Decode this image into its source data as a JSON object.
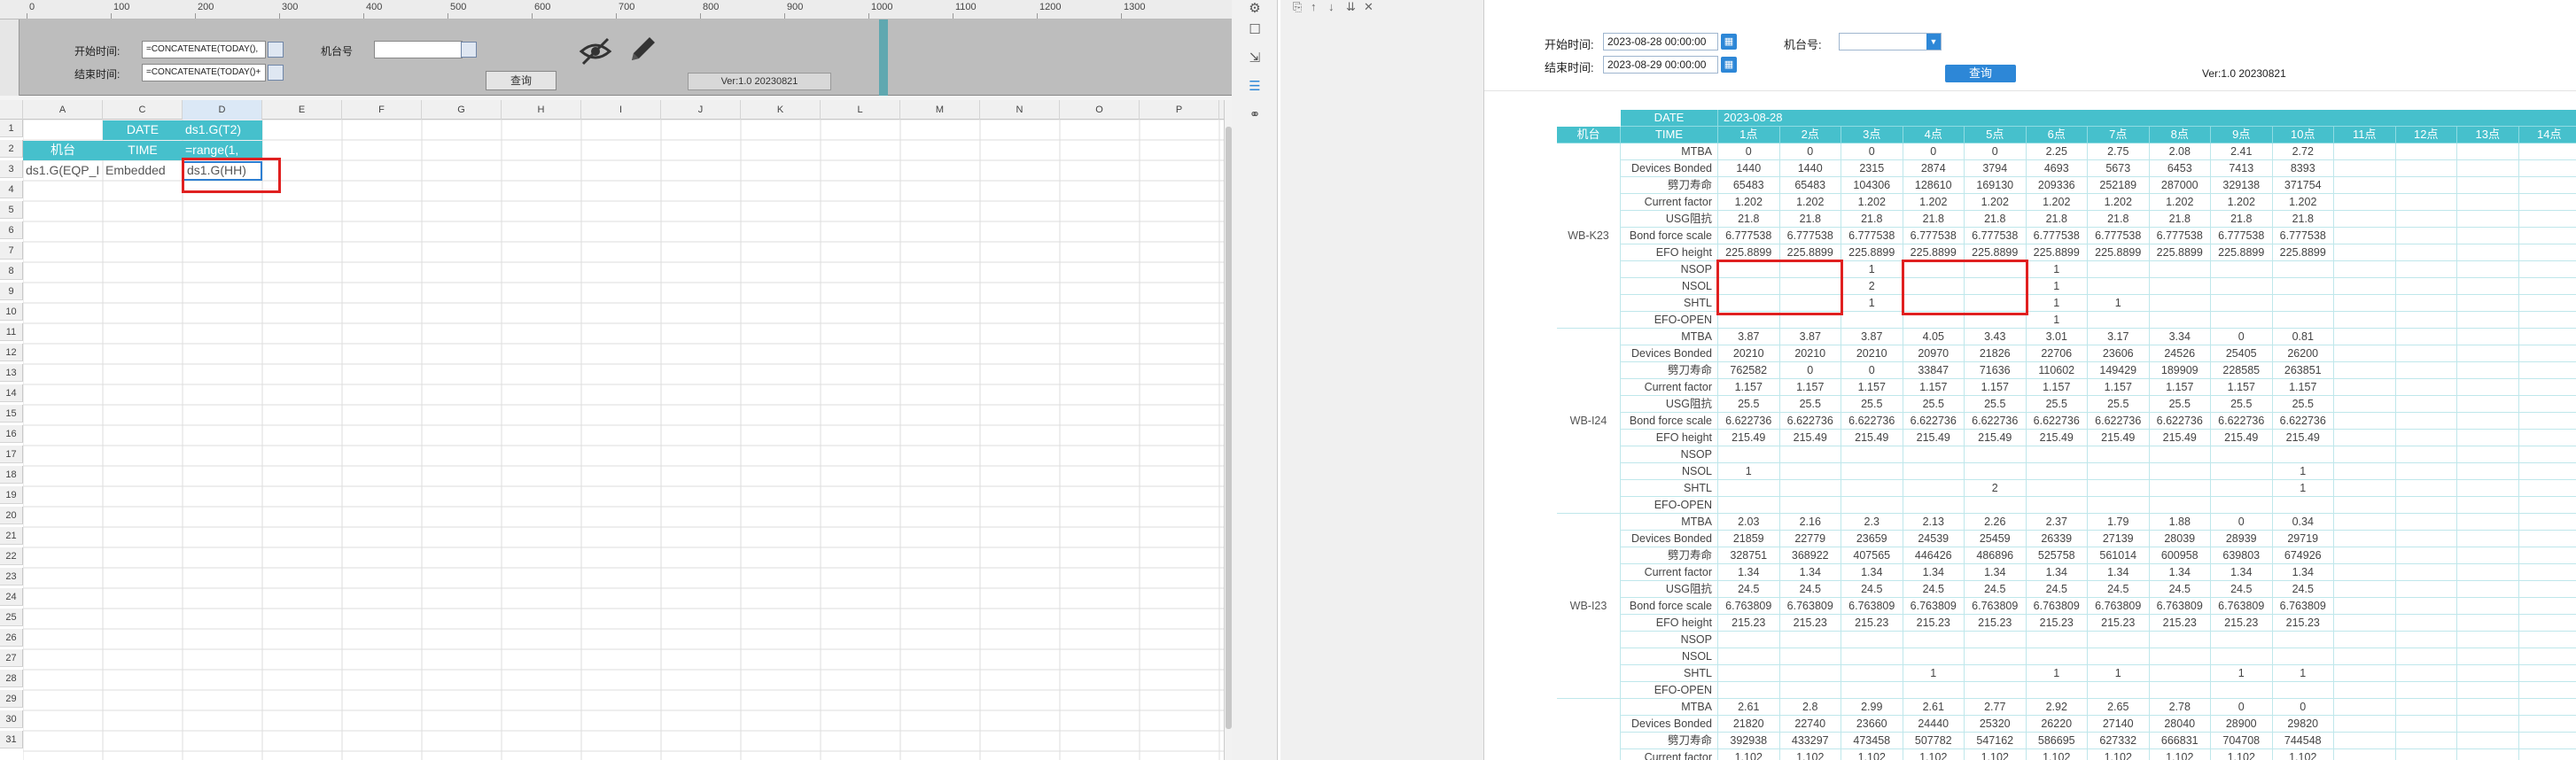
{
  "designer": {
    "ruler_ticks": [
      "0",
      "100",
      "200",
      "300",
      "400",
      "500",
      "600",
      "700",
      "800",
      "900",
      "1000",
      "1100",
      "1200",
      "1300"
    ],
    "form": {
      "start_label": "开始时间:",
      "start_value": "=CONCATENATE(TODAY(),",
      "end_label": "结束时间:",
      "end_value": "=CONCATENATE(TODAY()+",
      "machine_label": "机台号",
      "query_label": "查询",
      "version": "Ver:1.0 20230821"
    },
    "columns": [
      "A",
      "C",
      "D",
      "E",
      "F",
      "G",
      "H",
      "I",
      "J",
      "K",
      "L",
      "M",
      "N",
      "O",
      "P"
    ],
    "rows": [
      "1",
      "2",
      "3",
      "4",
      "5",
      "6",
      "7",
      "8",
      "9",
      "10",
      "11",
      "12",
      "13",
      "14",
      "15",
      "16",
      "17",
      "18",
      "19",
      "20",
      "21",
      "22",
      "23",
      "24",
      "25",
      "26",
      "27",
      "28",
      "29",
      "30",
      "31"
    ],
    "cells": {
      "c1": "DATE",
      "d1": "ds1.G(T2)",
      "a2": "机台",
      "c2": "TIME",
      "d2": "=range(1,",
      "a3": "ds1.G(EQP_I",
      "c3": "Embedded",
      "d3": "ds1.G(HH)"
    }
  },
  "preview": {
    "start_label": "开始时间:",
    "start_value": "2023-08-28 00:00:00",
    "end_label": "结束时间:",
    "end_value": "2023-08-29 00:00:00",
    "machine_label": "机台号:",
    "machine_value": "",
    "query_label": "查询",
    "version": "Ver:1.0 20230821",
    "report": {
      "date_label": "DATE",
      "date_value": "2023-08-28",
      "time_label": "TIME",
      "machine_col_label": "机台",
      "hours": [
        "1点",
        "2点",
        "3点",
        "4点",
        "5点",
        "6点",
        "7点",
        "8点",
        "9点",
        "10点",
        "11点",
        "12点",
        "13点",
        "14点"
      ],
      "metrics": [
        "MTBA",
        "Devices Bonded",
        "劈刀寿命",
        "Current factor",
        "USG阻抗",
        "Bond force scale",
        "EFO height",
        "NSOP",
        "NSOL",
        "SHTL",
        "EFO-OPEN"
      ],
      "groups": [
        {
          "machine": "WB-K23",
          "values": [
            [
              "0",
              "0",
              "0",
              "0",
              "0",
              "2.25",
              "2.75",
              "2.08",
              "2.41",
              "2.72"
            ],
            [
              "1440",
              "1440",
              "2315",
              "2874",
              "3794",
              "4693",
              "5673",
              "6453",
              "7413",
              "8393"
            ],
            [
              "65483",
              "65483",
              "104306",
              "128610",
              "169130",
              "209336",
              "252189",
              "287000",
              "329138",
              "371754"
            ],
            [
              "1.202",
              "1.202",
              "1.202",
              "1.202",
              "1.202",
              "1.202",
              "1.202",
              "1.202",
              "1.202",
              "1.202"
            ],
            [
              "21.8",
              "21.8",
              "21.8",
              "21.8",
              "21.8",
              "21.8",
              "21.8",
              "21.8",
              "21.8",
              "21.8"
            ],
            [
              "6.777538",
              "6.777538",
              "6.777538",
              "6.777538",
              "6.777538",
              "6.777538",
              "6.777538",
              "6.777538",
              "6.777538",
              "6.777538"
            ],
            [
              "225.8899",
              "225.8899",
              "225.8899",
              "225.8899",
              "225.8899",
              "225.8899",
              "225.8899",
              "225.8899",
              "225.8899",
              "225.8899"
            ],
            [
              "",
              "",
              "1",
              "",
              "",
              "1",
              "",
              "",
              "",
              ""
            ],
            [
              "",
              "",
              "2",
              "",
              "",
              "1",
              "",
              "",
              "",
              ""
            ],
            [
              "",
              "",
              "1",
              "",
              "",
              "1",
              "1",
              "",
              "",
              ""
            ],
            [
              "",
              "",
              "",
              "",
              "",
              "1",
              "",
              "",
              "",
              ""
            ]
          ]
        },
        {
          "machine": "WB-I24",
          "values": [
            [
              "3.87",
              "3.87",
              "3.87",
              "4.05",
              "3.43",
              "3.01",
              "3.17",
              "3.34",
              "0",
              "0.81"
            ],
            [
              "20210",
              "20210",
              "20210",
              "20970",
              "21826",
              "22706",
              "23606",
              "24526",
              "25405",
              "26200"
            ],
            [
              "762582",
              "0",
              "0",
              "33847",
              "71636",
              "110602",
              "149429",
              "189909",
              "228585",
              "263851"
            ],
            [
              "1.157",
              "1.157",
              "1.157",
              "1.157",
              "1.157",
              "1.157",
              "1.157",
              "1.157",
              "1.157",
              "1.157"
            ],
            [
              "25.5",
              "25.5",
              "25.5",
              "25.5",
              "25.5",
              "25.5",
              "25.5",
              "25.5",
              "25.5",
              "25.5"
            ],
            [
              "6.622736",
              "6.622736",
              "6.622736",
              "6.622736",
              "6.622736",
              "6.622736",
              "6.622736",
              "6.622736",
              "6.622736",
              "6.622736"
            ],
            [
              "215.49",
              "215.49",
              "215.49",
              "215.49",
              "215.49",
              "215.49",
              "215.49",
              "215.49",
              "215.49",
              "215.49"
            ],
            [
              "",
              "",
              "",
              "",
              "",
              "",
              "",
              "",
              "",
              ""
            ],
            [
              "1",
              "",
              "",
              "",
              "",
              "",
              "",
              "",
              "",
              "1"
            ],
            [
              "",
              "",
              "",
              "",
              "2",
              "",
              "",
              "",
              "",
              "1"
            ],
            [
              "",
              "",
              "",
              "",
              "",
              "",
              "",
              "",
              "",
              ""
            ]
          ]
        },
        {
          "machine": "WB-I23",
          "values": [
            [
              "2.03",
              "2.16",
              "2.3",
              "2.13",
              "2.26",
              "2.37",
              "1.79",
              "1.88",
              "0",
              "0.34"
            ],
            [
              "21859",
              "22779",
              "23659",
              "24539",
              "25459",
              "26339",
              "27139",
              "28039",
              "28939",
              "29719"
            ],
            [
              "328751",
              "368922",
              "407565",
              "446426",
              "486896",
              "525758",
              "561014",
              "600958",
              "639803",
              "674926"
            ],
            [
              "1.34",
              "1.34",
              "1.34",
              "1.34",
              "1.34",
              "1.34",
              "1.34",
              "1.34",
              "1.34",
              "1.34"
            ],
            [
              "24.5",
              "24.5",
              "24.5",
              "24.5",
              "24.5",
              "24.5",
              "24.5",
              "24.5",
              "24.5",
              "24.5"
            ],
            [
              "6.763809",
              "6.763809",
              "6.763809",
              "6.763809",
              "6.763809",
              "6.763809",
              "6.763809",
              "6.763809",
              "6.763809",
              "6.763809"
            ],
            [
              "215.23",
              "215.23",
              "215.23",
              "215.23",
              "215.23",
              "215.23",
              "215.23",
              "215.23",
              "215.23",
              "215.23"
            ],
            [
              "",
              "",
              "",
              "",
              "",
              "",
              "",
              "",
              "",
              ""
            ],
            [
              "",
              "",
              "",
              "",
              "",
              "",
              "",
              "",
              "",
              ""
            ],
            [
              "",
              "",
              "",
              "1",
              "",
              "1",
              "1",
              "",
              "1",
              "1"
            ],
            [
              "",
              "",
              "",
              "",
              "",
              "",
              "",
              "",
              "",
              ""
            ]
          ]
        },
        {
          "machine": "",
          "values": [
            [
              "2.61",
              "2.8",
              "2.99",
              "2.61",
              "2.77",
              "2.92",
              "2.65",
              "2.78",
              "0",
              "0"
            ],
            [
              "21820",
              "22740",
              "23660",
              "24440",
              "25320",
              "26220",
              "27140",
              "28040",
              "28900",
              "29820"
            ],
            [
              "392938",
              "433297",
              "473458",
              "507782",
              "547162",
              "586695",
              "627332",
              "666831",
              "704708",
              "744548"
            ],
            [
              "1.102",
              "1.102",
              "1.102",
              "1.102",
              "1.102",
              "1.102",
              "1.102",
              "1.102",
              "1.102",
              "1.102"
            ]
          ]
        }
      ]
    }
  }
}
